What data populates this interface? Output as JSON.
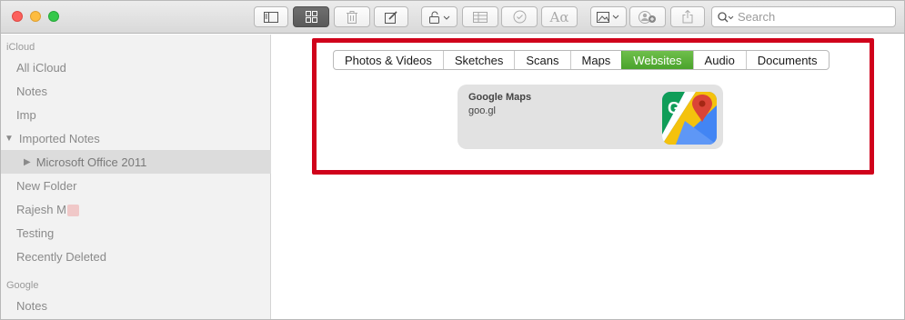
{
  "toolbar": {
    "search_placeholder": "Search",
    "buttons": [
      "sidebar-toggle",
      "gallery-view",
      "delete",
      "compose",
      "lock",
      "table",
      "checklist",
      "format",
      "media",
      "add-people",
      "share"
    ]
  },
  "sidebar": {
    "sections": [
      {
        "header": "iCloud",
        "items": [
          {
            "label": "All iCloud"
          },
          {
            "label": "Notes"
          },
          {
            "label": "Imp"
          },
          {
            "label": "Imported Notes",
            "expanded": true
          },
          {
            "label": "Microsoft Office 2011",
            "selected": true
          },
          {
            "label": "New Folder"
          },
          {
            "label": "Rajesh M"
          },
          {
            "label": "Testing"
          },
          {
            "label": "Recently Deleted"
          }
        ]
      },
      {
        "header": "Google",
        "items": [
          {
            "label": "Notes"
          }
        ]
      }
    ]
  },
  "attachments": {
    "tabs": [
      {
        "label": "Photos & Videos"
      },
      {
        "label": "Sketches"
      },
      {
        "label": "Scans"
      },
      {
        "label": "Maps"
      },
      {
        "label": "Websites",
        "active": true
      },
      {
        "label": "Audio"
      },
      {
        "label": "Documents"
      }
    ],
    "card": {
      "title": "Google Maps",
      "subtitle": "goo.gl",
      "icon": "google-maps-icon"
    }
  },
  "colors": {
    "active_tab": "#5bb23a",
    "highlight_border": "#d0021b"
  }
}
